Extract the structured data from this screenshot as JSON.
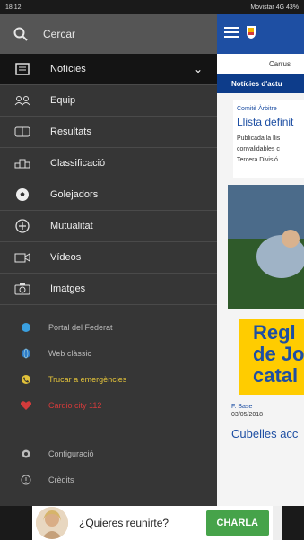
{
  "status": {
    "time": "18:12",
    "right": "Movistar 4G 43%"
  },
  "drawer": {
    "search_label": "Cercar",
    "menu": [
      {
        "label": "Notícies",
        "icon": "news-icon"
      },
      {
        "label": "Equip",
        "icon": "team-icon"
      },
      {
        "label": "Resultats",
        "icon": "results-icon"
      },
      {
        "label": "Classificació",
        "icon": "standings-icon"
      },
      {
        "label": "Golejadors",
        "icon": "soccer-ball-icon"
      },
      {
        "label": "Mutualitat",
        "icon": "plus-circle-icon"
      },
      {
        "label": "Vídeos",
        "icon": "video-icon"
      },
      {
        "label": "Imatges",
        "icon": "camera-icon"
      }
    ],
    "links": [
      {
        "label": "Portal del Federat",
        "color": "#bbbbbb"
      },
      {
        "label": "Web clàssic",
        "color": "#bbbbbb"
      },
      {
        "label": "Trucar a emergències",
        "color": "#e2c23a"
      },
      {
        "label": "Cardio city 112",
        "color": "#d43b3b"
      }
    ],
    "footer": [
      {
        "label": "Configuració"
      },
      {
        "label": "Crèdits"
      }
    ]
  },
  "content": {
    "subtab": "Carrus",
    "news_header": "Notícies d'actu",
    "card_category": "Comitè Àrbitre",
    "card_title": "Llista definit",
    "card_body": [
      "Publicada la llis",
      "convalidables c",
      "Tercera Divisió"
    ],
    "poster_lines": [
      "Regl",
      "de Jo",
      "catal"
    ],
    "meta1": "F. Base",
    "meta2": "03/05/2018",
    "big": "Cubelles acc"
  },
  "ad": {
    "text": "¿Quieres reunirte?",
    "button": "CHARLA"
  }
}
